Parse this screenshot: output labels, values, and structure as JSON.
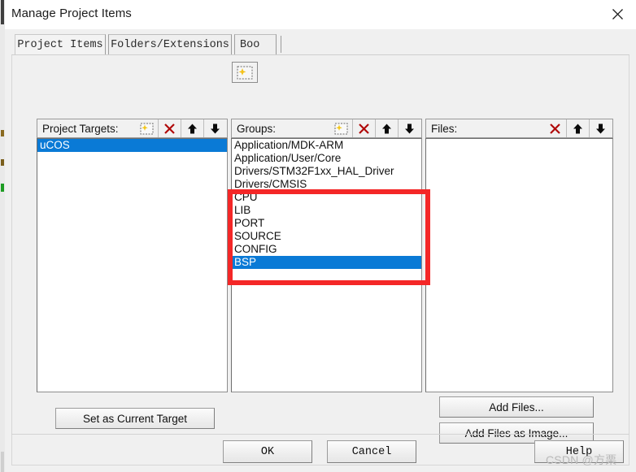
{
  "window": {
    "title": "Manage Project Items",
    "close_icon": "close-icon"
  },
  "tabs": [
    {
      "label": "Project Items",
      "active": true
    },
    {
      "label": "Folders/Extensions",
      "active": false
    },
    {
      "label": "Boo",
      "active": false
    }
  ],
  "floating_icon": "new-item-icon",
  "panels": {
    "targets": {
      "label": "Project Targets:",
      "tools": [
        "new-item-icon",
        "delete-icon",
        "move-up-icon",
        "move-down-icon"
      ],
      "items": [
        {
          "label": "uCOS",
          "selected": true
        }
      ]
    },
    "groups": {
      "label": "Groups:",
      "tools": [
        "new-item-icon",
        "delete-icon",
        "move-up-icon",
        "move-down-icon"
      ],
      "items": [
        {
          "label": "Application/MDK-ARM",
          "selected": false
        },
        {
          "label": "Application/User/Core",
          "selected": false
        },
        {
          "label": "Drivers/STM32F1xx_HAL_Driver",
          "selected": false
        },
        {
          "label": "Drivers/CMSIS",
          "selected": false
        },
        {
          "label": "CPU",
          "selected": false
        },
        {
          "label": "LIB",
          "selected": false
        },
        {
          "label": "PORT",
          "selected": false
        },
        {
          "label": "SOURCE",
          "selected": false
        },
        {
          "label": "CONFIG",
          "selected": false
        },
        {
          "label": "BSP",
          "selected": true
        }
      ]
    },
    "files": {
      "label": "Files:",
      "tools": [
        "delete-icon",
        "move-up-icon",
        "move-down-icon"
      ],
      "items": []
    }
  },
  "buttons": {
    "set_as_current_target": "Set as Current Target",
    "add_files": "Add Files...",
    "add_files_as_image": "Add Files as Image...",
    "ok": "OK",
    "cancel": "Cancel",
    "help": "Help"
  },
  "annotation": {
    "color": "#f42727"
  },
  "watermark": "CSDN @方栗"
}
